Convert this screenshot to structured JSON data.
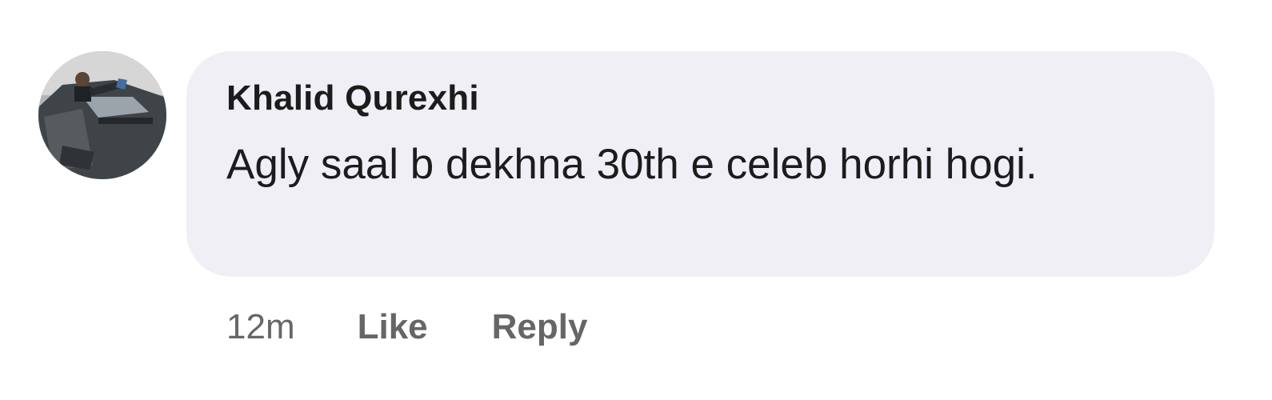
{
  "comment": {
    "author": "Khalid Qurexhi",
    "text": "Agly saal b dekhna 30th e celeb horhi hogi.",
    "timestamp": "12m",
    "actions": {
      "like_label": "Like",
      "reply_label": "Reply"
    }
  },
  "colors": {
    "bubble_background": "#f0eff6",
    "author_text": "#1c1c1c",
    "meta_text": "#666666"
  }
}
